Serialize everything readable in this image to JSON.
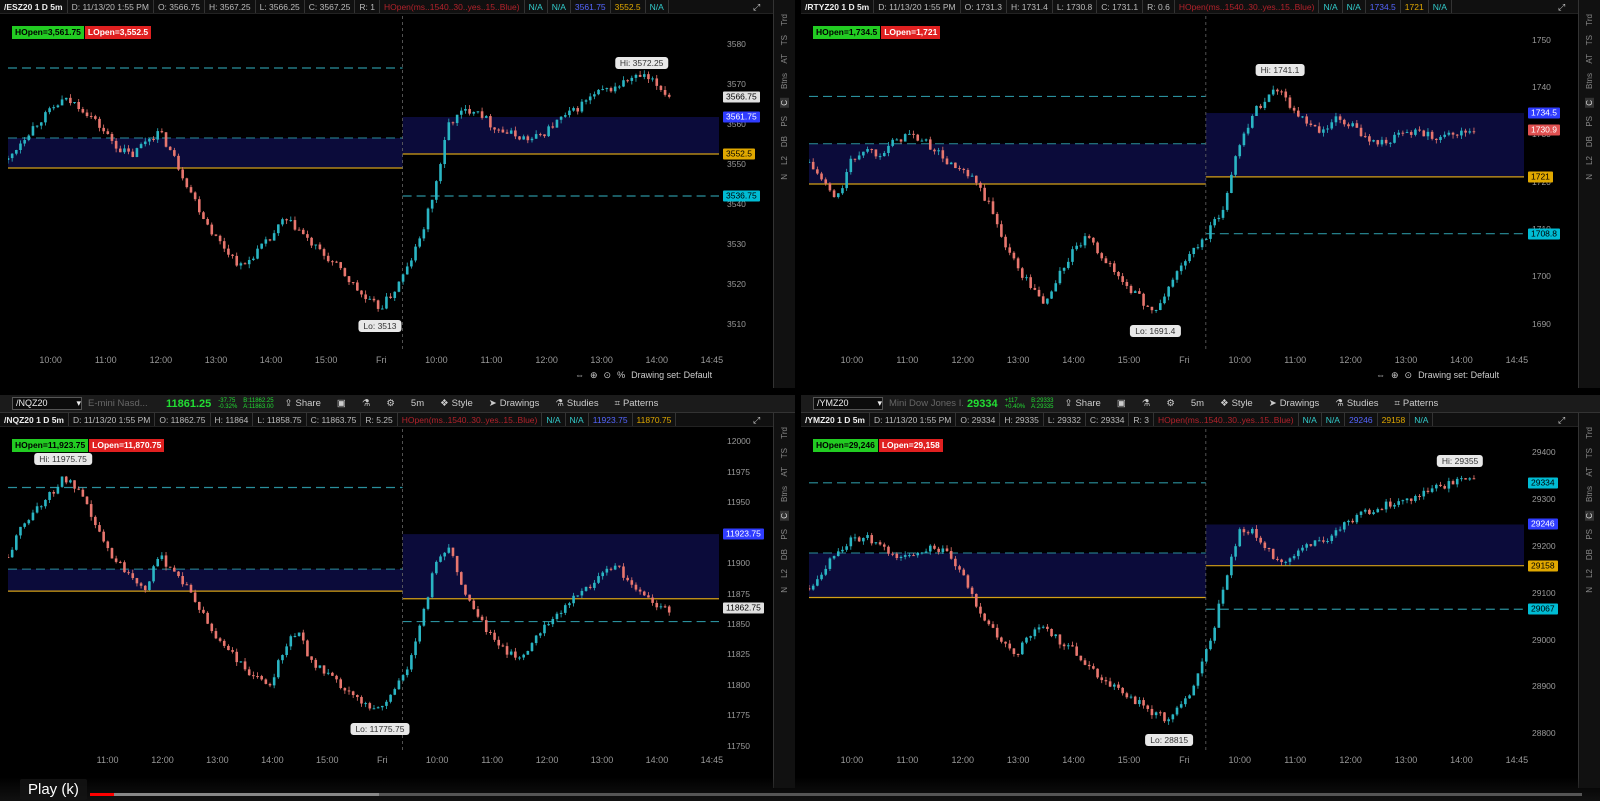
{
  "panels": [
    {
      "id": "es",
      "control": null,
      "header": {
        "symbol": "/ESZ20 1 D 5m",
        "date": "D: 11/13/20 1:55 PM",
        "o": "O: 3566.75",
        "h": "H: 3567.25",
        "l": "L: 3566.25",
        "c": "C: 3567.25",
        "r": "R: 1",
        "study": "HOpen(ms..1540..30..yes..15..Blue)",
        "na1": "N/A",
        "na2": "N/A",
        "v1": "3561.75",
        "v2": "3552.5",
        "na3": "N/A"
      },
      "legend": {
        "hopen": "HOpen=3,561.75",
        "lopen": "LOpen=3,552.5"
      },
      "hi_label": "Hi: 3572.25",
      "lo_label": "Lo: 3513",
      "hi_val": 3572.25,
      "lo_val": 3513,
      "y_min": 3503,
      "y_max": 3587,
      "y_ticks": [
        3580,
        3570,
        3560,
        3550,
        3540,
        3530,
        3520,
        3510
      ],
      "levels": {
        "dash_high": 3574,
        "hopen_prev": 3556.5,
        "lopen_prev": 3549,
        "dash_low": 3552.5,
        "hopen": 3561.75,
        "lopen": 3552.5,
        "dash_low2": 3542
      },
      "tags": [
        {
          "text": "3566.75",
          "value": 3566.75,
          "color": "#ffffff",
          "bg": "#e0e0e0",
          "fg": "#000000"
        },
        {
          "text": "3561.75",
          "value": 3561.75,
          "bg": "#2f3cff",
          "fg": "#ffffff"
        },
        {
          "text": "3552.5",
          "value": 3552.5,
          "bg": "#e0a800",
          "fg": "#000000"
        },
        {
          "text": "3536.75",
          "value": 3542,
          "bg": "#00bcd4",
          "fg": "#000000"
        }
      ],
      "x_ticks": [
        "10:00",
        "11:00",
        "12:00",
        "13:00",
        "14:00",
        "15:00",
        "Fri",
        "10:00",
        "11:00",
        "12:00",
        "13:00",
        "14:00",
        "14:45"
      ],
      "bottom": {
        "drawing": "Drawing set: Default",
        "pct": "%"
      },
      "path": [
        3551,
        3556,
        3560,
        3563,
        3566,
        3565,
        3562,
        3558,
        3554,
        3552,
        3556,
        3558,
        3552,
        3545,
        3538,
        3532,
        3528,
        3524,
        3528,
        3531,
        3536,
        3534,
        3530,
        3527,
        3524,
        3520,
        3516,
        3514,
        3518,
        3524,
        3532,
        3544,
        3560,
        3563,
        3564,
        3560,
        3558,
        3557,
        3556,
        3558,
        3561,
        3563,
        3566,
        3568,
        3569,
        3571,
        3572,
        3570,
        3567
      ]
    },
    {
      "id": "rty",
      "control": null,
      "header": {
        "symbol": "/RTYZ20 1 D 5m",
        "date": "D: 11/13/20 1:55 PM",
        "o": "O: 1731.3",
        "h": "H: 1731.4",
        "l": "L: 1730.8",
        "c": "C: 1731.1",
        "r": "R: 0.6",
        "study": "HOpen(ms..1540..30..yes..15..Blue)",
        "na1": "N/A",
        "na2": "N/A",
        "v1": "1734.5",
        "v2": "1721",
        "na3": "N/A"
      },
      "legend": {
        "hopen": "HOpen=1,734.5",
        "lopen": "LOpen=1,721"
      },
      "hi_label": "Hi: 1741.1",
      "lo_label": "Lo: 1691.4",
      "hi_val": 1741.1,
      "lo_val": 1691.4,
      "y_min": 1684,
      "y_max": 1755,
      "y_ticks": [
        1750,
        1740,
        1730,
        1720,
        1710,
        1700,
        1690
      ],
      "levels": {
        "dash_high": 1738,
        "hopen_prev": 1728,
        "lopen_prev": 1719.5,
        "dash_low": 1710,
        "hopen": 1734.5,
        "lopen": 1721,
        "dash_low2": 1709
      },
      "tags": [
        {
          "text": "1734.5",
          "value": 1734.5,
          "bg": "#2f3cff",
          "fg": "#ffffff"
        },
        {
          "text": "1730.9",
          "value": 1731,
          "bg": "#e05050",
          "fg": "#ffffff"
        },
        {
          "text": "1721",
          "value": 1721,
          "bg": "#e0a800",
          "fg": "#000000"
        },
        {
          "text": "1708.8",
          "value": 1709,
          "bg": "#00bcd4",
          "fg": "#000000"
        }
      ],
      "x_ticks": [
        "10:00",
        "11:00",
        "12:00",
        "13:00",
        "14:00",
        "15:00",
        "Fri",
        "10:00",
        "11:00",
        "12:00",
        "13:00",
        "14:00",
        "14:45"
      ],
      "bottom": {
        "drawing": "Drawing set: Default",
        "pct": ""
      },
      "path": [
        1724,
        1720,
        1716,
        1724,
        1727,
        1726,
        1728,
        1730,
        1729,
        1727,
        1724,
        1722,
        1720,
        1715,
        1708,
        1702,
        1698,
        1694,
        1700,
        1705,
        1708,
        1705,
        1701,
        1698,
        1695,
        1692,
        1698,
        1703,
        1706,
        1710,
        1715,
        1728,
        1734,
        1738,
        1740,
        1735,
        1732,
        1730,
        1733,
        1732,
        1730,
        1728,
        1729,
        1730,
        1731,
        1729,
        1731,
        1730,
        1731
      ]
    },
    {
      "id": "nq",
      "control": {
        "symbol": "/NQZ20",
        "desc": "E-mini Nasd...",
        "last": "11861.25",
        "chg1": "-37.75",
        "chg2": "-0.32%",
        "bid": "B:11862.25",
        "ask": "A:11863.00",
        "share": "Share",
        "period": "5m",
        "style": "Style",
        "drawings": "Drawings",
        "studies": "Studies",
        "patterns": "Patterns"
      },
      "header": {
        "symbol": "/NQZ20 1 D 5m",
        "date": "D: 11/13/20 1:55 PM",
        "o": "O: 11862.75",
        "h": "H: 11864",
        "l": "L: 11858.75",
        "c": "C: 11863.75",
        "r": "R: 5.25",
        "study": "HOpen(ms..1540..30..yes..15..Blue)",
        "na1": "N/A",
        "na2": "N/A",
        "v1": "11923.75",
        "v2": "11870.75",
        "na3": ""
      },
      "legend": {
        "hopen": "HOpen=11,923.75",
        "lopen": "LOpen=11,870.75"
      },
      "hi_label": "Hi: 11975.75",
      "lo_label": "Lo: 11775.75",
      "hi_val": 11975.75,
      "lo_val": 11775.75,
      "y_min": 11745,
      "y_max": 12010,
      "y_ticks": [
        12000,
        11975,
        11950,
        11925,
        11900,
        11875,
        11850,
        11825,
        11800,
        11775,
        11750
      ],
      "levels": {
        "dash_high": 11962,
        "hopen_prev": 11895,
        "lopen_prev": 11877,
        "dash_low": 11850,
        "hopen": 11923.75,
        "lopen": 11870.75,
        "dash_low2": 11852
      },
      "tags": [
        {
          "text": "11923.75",
          "value": 11923.75,
          "bg": "#2f3cff",
          "fg": "#ffffff"
        },
        {
          "text": "11862.75",
          "value": 11862.75,
          "bg": "#e0e0e0",
          "fg": "#000000"
        }
      ],
      "x_ticks": [
        "11:00",
        "12:00",
        "13:00",
        "14:00",
        "15:00",
        "Fri",
        "10:00",
        "11:00",
        "12:00",
        "13:00",
        "14:00",
        "14:45"
      ],
      "bottom": {
        "drawing": "",
        "pct": ""
      },
      "path": [
        11905,
        11930,
        11945,
        11955,
        11970,
        11960,
        11940,
        11915,
        11900,
        11890,
        11880,
        11905,
        11895,
        11880,
        11860,
        11840,
        11830,
        11815,
        11805,
        11800,
        11830,
        11845,
        11820,
        11810,
        11800,
        11790,
        11785,
        11780,
        11795,
        11815,
        11850,
        11900,
        11915,
        11880,
        11860,
        11840,
        11830,
        11820,
        11835,
        11850,
        11860,
        11870,
        11880,
        11890,
        11900,
        11885,
        11875,
        11865,
        11862
      ]
    },
    {
      "id": "ym",
      "control": {
        "symbol": "/YMZ20",
        "desc": "Mini Dow Jones I...",
        "last": "29334",
        "chg1": "+117",
        "chg2": "+0.40%",
        "bid": "B:29333",
        "ask": "A:29335",
        "share": "Share",
        "period": "5m",
        "style": "Style",
        "drawings": "Drawings",
        "studies": "Studies",
        "patterns": "Patterns"
      },
      "header": {
        "symbol": "/YMZ20 1 D 5m",
        "date": "D: 11/13/20 1:55 PM",
        "o": "O: 29334",
        "h": "H: 29335",
        "l": "L: 29332",
        "c": "C: 29334",
        "r": "R: 3",
        "study": "HOpen(ms..1540..30..yes..15..Blue)",
        "na1": "N/A",
        "na2": "N/A",
        "v1": "29246",
        "v2": "29158",
        "na3": "N/A"
      },
      "legend": {
        "hopen": "HOpen=29,246",
        "lopen": "LOpen=29,158"
      },
      "hi_label": "Hi: 29355",
      "lo_label": "Lo: 28815",
      "hi_val": 29355,
      "lo_val": 28815,
      "y_min": 28760,
      "y_max": 29450,
      "y_ticks": [
        29400,
        29300,
        29200,
        29100,
        29000,
        28900,
        28800
      ],
      "levels": {
        "dash_high": 29335,
        "hopen_prev": 29185,
        "lopen_prev": 29090,
        "dash_low": 29065,
        "hopen": 29246,
        "lopen": 29158,
        "dash_low2": 29065
      },
      "tags": [
        {
          "text": "29334",
          "value": 29334,
          "bg": "#00bcd4",
          "fg": "#000000"
        },
        {
          "text": "29246",
          "value": 29246,
          "bg": "#2f3cff",
          "fg": "#ffffff"
        },
        {
          "text": "29158",
          "value": 29158,
          "bg": "#e0a800",
          "fg": "#000000"
        },
        {
          "text": "29067",
          "value": 29065,
          "bg": "#00bcd4",
          "fg": "#000000"
        }
      ],
      "x_ticks": [
        "10:00",
        "11:00",
        "12:00",
        "13:00",
        "14:00",
        "15:00",
        "Fri",
        "10:00",
        "11:00",
        "12:00",
        "13:00",
        "14:00",
        "14:45"
      ],
      "bottom": {
        "drawing": "",
        "pct": ""
      },
      "path": [
        29110,
        29150,
        29190,
        29210,
        29220,
        29200,
        29180,
        29175,
        29190,
        29200,
        29180,
        29140,
        29080,
        29030,
        28990,
        28970,
        29010,
        29030,
        29000,
        28980,
        28950,
        28920,
        28900,
        28880,
        28860,
        28840,
        28830,
        28860,
        28920,
        29000,
        29120,
        29230,
        29230,
        29190,
        29170,
        29180,
        29200,
        29210,
        29230,
        29250,
        29270,
        29280,
        29290,
        29300,
        29310,
        29320,
        29330,
        29340,
        29335
      ]
    }
  ],
  "toolbar_labels": {
    "trd": "Trd",
    "ts": "TS",
    "at": "AT",
    "btns": "Btns",
    "c": "C",
    "ps": "PS",
    "db": "DB",
    "l2": "L2",
    "n": "N"
  },
  "player": {
    "play": "Play (k)"
  },
  "colors": {
    "bull": "#2ab5c3",
    "bear": "#e8766e",
    "gold": "#d4a017",
    "dash": "#2a8f9c",
    "fill": "#0b0b3a"
  }
}
